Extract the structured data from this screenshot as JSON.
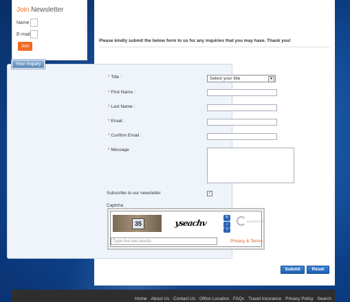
{
  "newsletter": {
    "title_join": "Join",
    "title_rest": " Newsletter",
    "name_label": "Name",
    "email_label": "E-mail",
    "join_button": "Join"
  },
  "intro": "Please kindly submit the below form to us for any inquiries that you may have. Thank you!",
  "form": {
    "legend": "Your Inquiry",
    "title_label": "Title :",
    "title_select": "Select your title",
    "first_name_label": "First Name :",
    "last_name_label": "Last Name :",
    "email_label": "Email :",
    "confirm_email_label": "Confirm Email :",
    "message_label": "Message",
    "required_mark": "*",
    "subscribe_label": "Subscribe to our newsletter",
    "subscribe_checked": "✓",
    "captcha_label": "Captcha",
    "captcha_number": "35",
    "captcha_word": "yseachv",
    "captcha_placeholder": "Type the two words",
    "recaptcha_brand": "reCAPTCHA™",
    "privacy_terms": "Privacy & Terms",
    "submit_button": "Submit",
    "reset_button": "Reset"
  },
  "footer": {
    "links": [
      "Home",
      "About Us",
      "Contact Us",
      "Office Location",
      "FAQs",
      "Travel Insurance",
      "Privacy Policy",
      "Search"
    ]
  },
  "colors": {
    "accent": "#f16a22",
    "button_blue": "#1d5fb0",
    "footer_bg": "#2e2e2e"
  }
}
